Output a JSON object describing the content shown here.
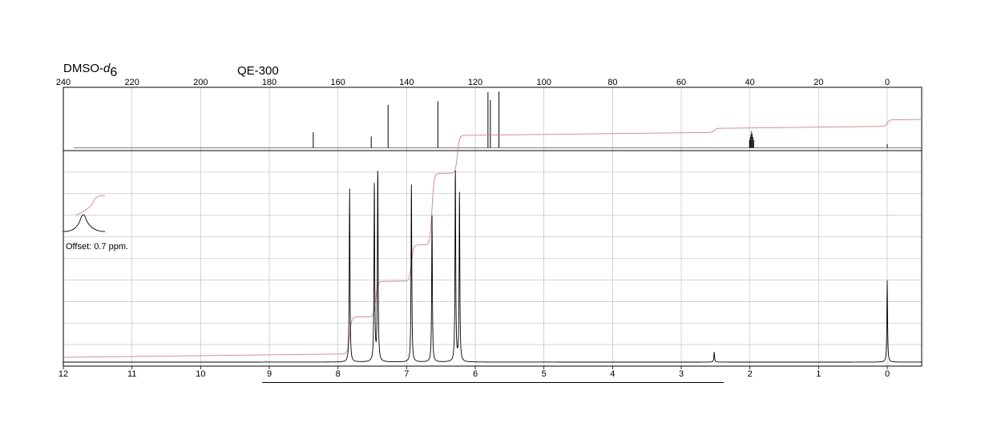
{
  "header": {
    "solvent_prefix": "DMSO-",
    "solvent_d": "d",
    "solvent_sub": "6",
    "instrument": "QE-300"
  },
  "chart_data": [
    {
      "type": "line",
      "name": "13C spectrum",
      "title": "",
      "xlabel": "",
      "ylabel": "",
      "xlim": [
        240,
        -10
      ],
      "x_reversed": true,
      "grid": true,
      "ticks": [
        240,
        220,
        200,
        180,
        160,
        140,
        120,
        100,
        80,
        60,
        40,
        20,
        0
      ],
      "tick_labels": [
        "240",
        "220",
        "200",
        "180",
        "160",
        "140",
        "120",
        "100",
        "80",
        "60",
        "40",
        "20",
        "0"
      ],
      "peaks": [
        {
          "ppm": 167.2,
          "height": 0.26
        },
        {
          "ppm": 150.3,
          "height": 0.19
        },
        {
          "ppm": 145.4,
          "height": 0.72
        },
        {
          "ppm": 130.9,
          "height": 0.78
        },
        {
          "ppm": 116.3,
          "height": 0.93
        },
        {
          "ppm": 115.6,
          "height": 0.8
        },
        {
          "ppm": 113.1,
          "height": 0.94
        },
        {
          "ppm": 39.5,
          "height": 0.28
        },
        {
          "ppm": 0.0,
          "height": 0.06
        }
      ]
    },
    {
      "type": "line",
      "name": "1H spectrum",
      "title": "",
      "xlabel": "",
      "ylabel": "",
      "xlim": [
        12,
        -0.5
      ],
      "x_reversed": true,
      "grid": true,
      "ticks": [
        12,
        11,
        10,
        9,
        8,
        7,
        6,
        5,
        4,
        3,
        2,
        1,
        0
      ],
      "tick_labels": [
        "12",
        "11",
        "10",
        "9",
        "8",
        "7",
        "6",
        "5",
        "4",
        "3",
        "2",
        "1",
        "0"
      ],
      "peaks": [
        {
          "ppm": 7.83,
          "height": 0.85
        },
        {
          "ppm": 7.47,
          "height": 0.88
        },
        {
          "ppm": 7.42,
          "height": 0.96
        },
        {
          "ppm": 6.93,
          "height": 0.89
        },
        {
          "ppm": 6.63,
          "height": 0.72
        },
        {
          "ppm": 6.29,
          "height": 0.96
        },
        {
          "ppm": 6.23,
          "height": 0.83
        },
        {
          "ppm": 2.52,
          "height": 0.05
        },
        {
          "ppm": 0.0,
          "height": 0.4
        }
      ],
      "offset_inset": {
        "label": "Offset: 0.7 ppm."
      }
    }
  ]
}
